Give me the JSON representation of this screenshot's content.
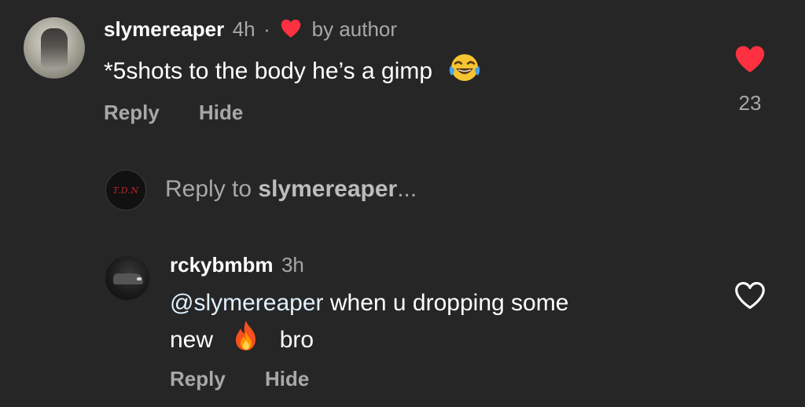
{
  "comment": {
    "username": "slymereaper",
    "time": "4h",
    "separator": "·",
    "badge": "by author",
    "text": "*5shots to the body he’s a gimp",
    "emoji": "face-with-tears-of-joy",
    "actions": {
      "reply": "Reply",
      "hide": "Hide"
    },
    "likes": "23",
    "liked": true,
    "like_color": "#ff3040"
  },
  "reply_box": {
    "avatar_text": "T.D.N",
    "prefix": "Reply to ",
    "target": "slymereaper",
    "suffix": "..."
  },
  "reply": {
    "username": "rckybmbm",
    "time": "3h",
    "mention": "@slymereaper",
    "text_line1": " when u dropping some",
    "text_line2_a": "new ",
    "emoji": "fire",
    "text_line2_b": " bro",
    "actions": {
      "reply": "Reply",
      "hide": "Hide"
    },
    "liked": false
  },
  "colors": {
    "background": "#262626",
    "primary_text": "#ffffff",
    "secondary_text": "#a8a8a8",
    "mention": "#e0f1ff",
    "like_red": "#ff3040"
  }
}
